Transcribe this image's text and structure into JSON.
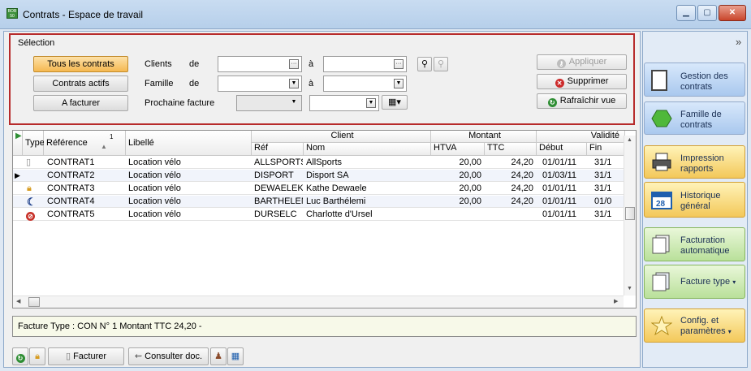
{
  "window": {
    "title": "Contrats - Espace de travail",
    "app_icon_text": "BOB 50"
  },
  "selection": {
    "title": "Sélection",
    "filters": [
      "Tous les contrats",
      "Contrats actifs",
      "A facturer"
    ],
    "clients_label": "Clients",
    "de_label": "de",
    "a_label": "à",
    "famille_label": "Famille",
    "prochaine_label": "Prochaine facture",
    "appliquer": "Appliquer",
    "supprimer": "Supprimer",
    "rafraichir": "Rafraîchir vue"
  },
  "grid": {
    "headers": {
      "type": "Type",
      "reference": "Référence",
      "sort_index": "1",
      "libelle": "Libellé",
      "client": "Client",
      "ref": "Réf",
      "nom": "Nom",
      "montant": "Montant",
      "htva": "HTVA",
      "ttc": "TTC",
      "validite": "Validité",
      "debut": "Début",
      "fin": "Fin"
    },
    "rows": [
      {
        "ref": "CONTRAT1",
        "libelle": "Location vélo",
        "client_ref": "ALLSPORTS",
        "nom": "AllSports",
        "htva": "20,00",
        "ttc": "24,20",
        "debut": "01/01/11",
        "fin": "31/1"
      },
      {
        "ref": "CONTRAT2",
        "libelle": "Location vélo",
        "client_ref": "DISPORT",
        "nom": "Disport SA",
        "htva": "20,00",
        "ttc": "24,20",
        "debut": "01/03/11",
        "fin": "31/1"
      },
      {
        "ref": "CONTRAT3",
        "libelle": "Location vélo",
        "client_ref": "DEWAELEK",
        "nom": "Kathe Dewaele",
        "htva": "20,00",
        "ttc": "24,20",
        "debut": "01/01/11",
        "fin": "31/1"
      },
      {
        "ref": "CONTRAT4",
        "libelle": "Location vélo",
        "client_ref": "BARTHELEM",
        "nom": "Luc Barthélemi",
        "htva": "20,00",
        "ttc": "24,20",
        "debut": "01/01/11",
        "fin": "01/0"
      },
      {
        "ref": "CONTRAT5",
        "libelle": "Location vélo",
        "client_ref": "DURSELC",
        "nom": "Charlotte d'Ursel",
        "htva": "",
        "ttc": "",
        "debut": "01/01/11",
        "fin": "31/1"
      }
    ]
  },
  "status": {
    "text": "Facture Type : CON N° 1 Montant TTC 24,20 -"
  },
  "bottombar": {
    "facturer": "Facturer",
    "consulter": "Consulter doc."
  },
  "sidebar": {
    "collapse": "»",
    "items": [
      {
        "label": "Gestion des contrats"
      },
      {
        "label": "Famille de contrats"
      },
      {
        "label": "Impression rapports"
      },
      {
        "label": "Historique général"
      },
      {
        "label": "Facturation automatique"
      },
      {
        "label": "Facture type"
      },
      {
        "label": "Config. et paramètres"
      }
    ]
  }
}
